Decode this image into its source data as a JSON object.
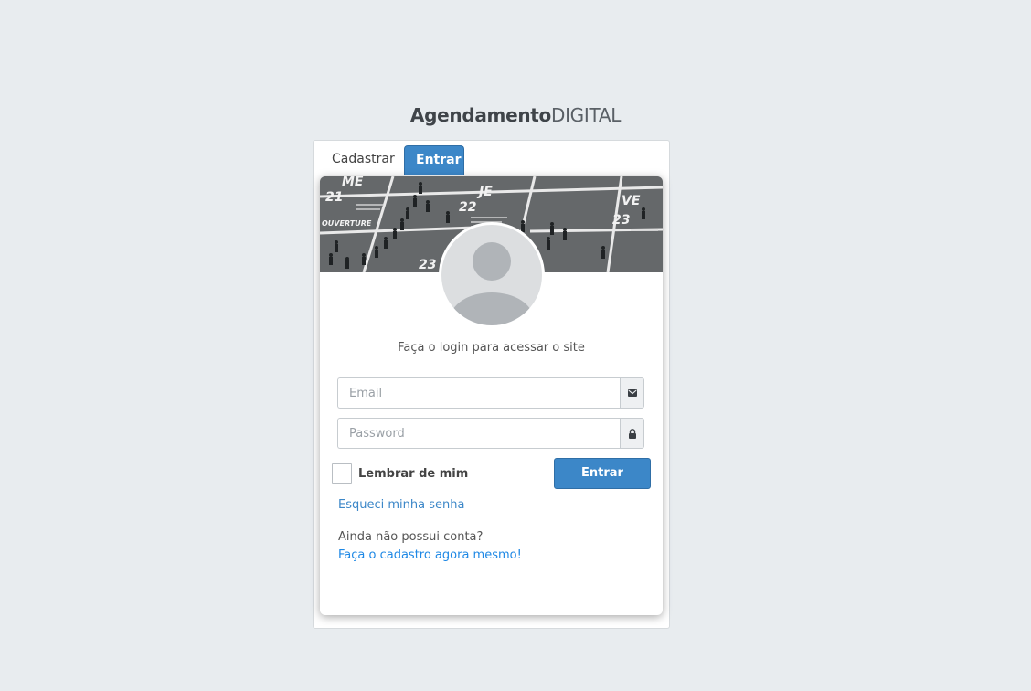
{
  "brand": {
    "bold": "Agendamento",
    "light": "DIGITAL"
  },
  "tabs": [
    {
      "label": "Cadastrar",
      "active": false
    },
    {
      "label": "Entrar",
      "active": true
    }
  ],
  "cover": {
    "days": [
      "ME",
      "21",
      "JE",
      "22",
      "VE",
      "23",
      "OUVERTURE",
      "23"
    ]
  },
  "login": {
    "subtitle": "Faça o login para acessar o site",
    "email_placeholder": "Email",
    "email_icon": "envelope-icon",
    "password_placeholder": "Password",
    "password_icon": "lock-icon",
    "remember_label": "Lembrar de mim",
    "remember_checked": false,
    "submit_label": "Entrar",
    "forgot_link": "Esqueci minha senha",
    "no_account_text": "Ainda não possui conta?",
    "signup_link": "Faça o cadastro agora mesmo!"
  },
  "colors": {
    "accent": "#3c87c8",
    "link": "#1e88e5",
    "background": "#e8ecef"
  }
}
